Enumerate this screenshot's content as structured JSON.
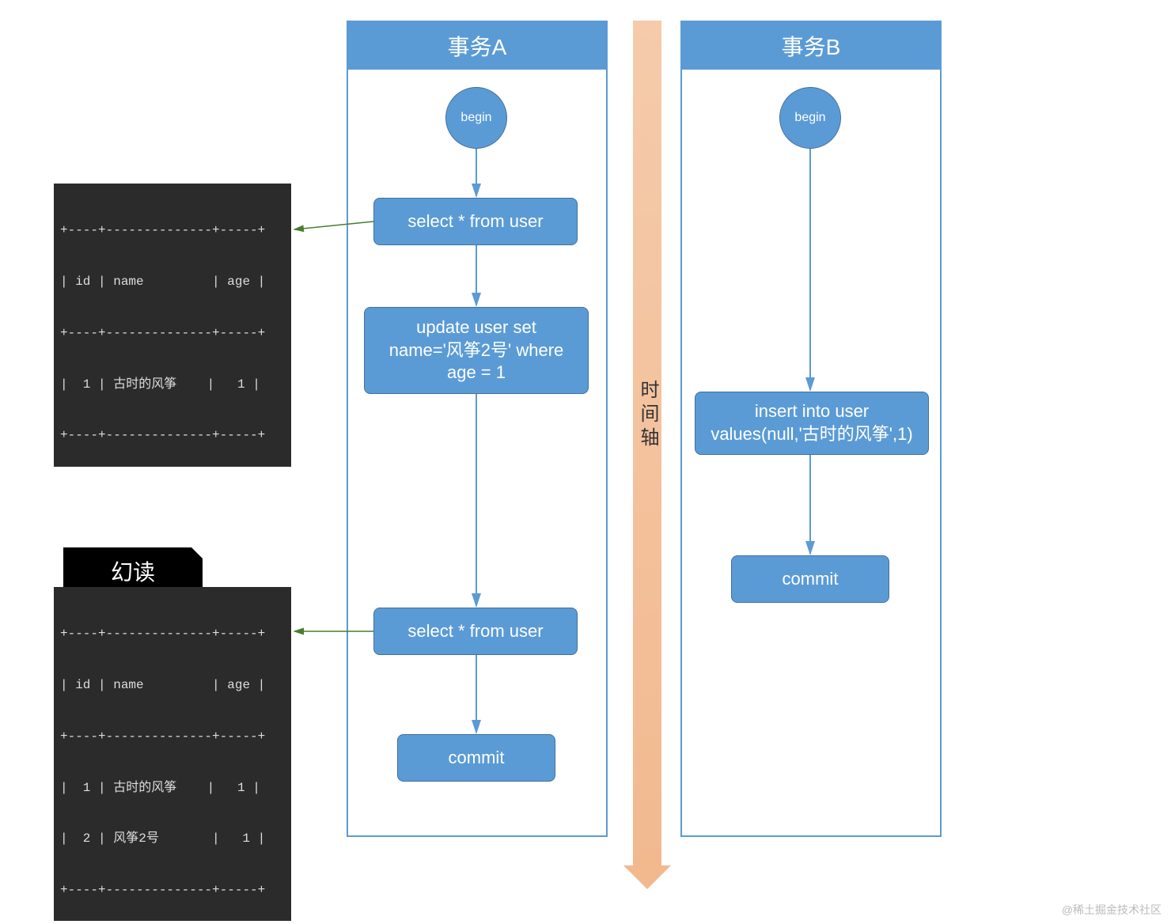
{
  "transaction_a": {
    "title": "事务A",
    "begin": "begin",
    "select1": "select * from user",
    "update": "update user set name='风筝2号' where age = 1",
    "select2": "select * from user",
    "commit": "commit"
  },
  "transaction_b": {
    "title": "事务B",
    "begin": "begin",
    "insert": "insert into user values(null,'古时的风筝',1)",
    "commit": "commit"
  },
  "time_axis_label": "时间轴",
  "result1": {
    "lines": [
      "+----+--------------+-----+",
      "| id | name         | age |",
      "+----+--------------+-----+",
      "|  1 | 古时的风筝    |   1 |",
      "+----+--------------+-----+"
    ]
  },
  "phantom_read_label": "幻读",
  "result2": {
    "lines": [
      "+----+--------------+-----+",
      "| id | name         | age |",
      "+----+--------------+-----+",
      "|  1 | 古时的风筝    |   1 |",
      "|  2 | 风筝2号       |   1 |",
      "+----+--------------+-----+"
    ]
  },
  "watermark": "@稀土掘金技术社区",
  "colors": {
    "node_fill": "#5b9bd5",
    "node_border": "#41719c",
    "arrow": "#5b9bd5",
    "green_arrow": "#4a7c2e",
    "time_axis": "#f2b98f"
  }
}
